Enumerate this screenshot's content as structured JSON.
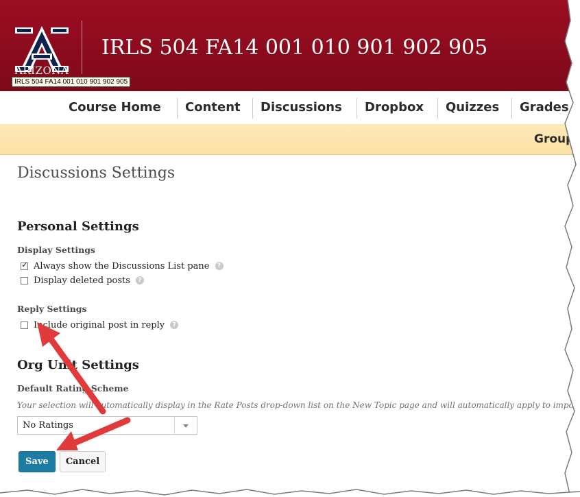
{
  "header": {
    "logo_word": "ARIZONA",
    "course_title": "IRLS 504 FA14 001 010 901 902 905",
    "tooltip": "IRLS 504 FA14 001 010 901 902 905",
    "brand_color": "#9c0d21"
  },
  "nav": {
    "items": [
      {
        "label": "Course Home"
      },
      {
        "label": "Content"
      },
      {
        "label": "Discussions"
      },
      {
        "label": "Dropbox"
      },
      {
        "label": "Quizzes"
      },
      {
        "label": "Grades"
      }
    ]
  },
  "subnav": {
    "item": "Group"
  },
  "page": {
    "title": "Discussions Settings",
    "personal_settings": {
      "heading": "Personal Settings",
      "display_settings": {
        "heading": "Display Settings",
        "options": [
          {
            "label": "Always show the Discussions List pane",
            "checked": true
          },
          {
            "label": "Display deleted posts",
            "checked": false
          }
        ]
      },
      "reply_settings": {
        "heading": "Reply Settings",
        "options": [
          {
            "label": "Include original post in reply",
            "checked": false
          }
        ]
      }
    },
    "org_unit_settings": {
      "heading": "Org Unit Settings",
      "rating_heading": "Default Rating Scheme",
      "description": "Your selection will automatically display in the Rate Posts drop-down list on the New Topic page and will automatically apply to impor",
      "select_value": "No Ratings"
    },
    "buttons": {
      "save": "Save",
      "cancel": "Cancel"
    }
  },
  "annotations": {
    "arrow_color": "#e03a3a"
  }
}
